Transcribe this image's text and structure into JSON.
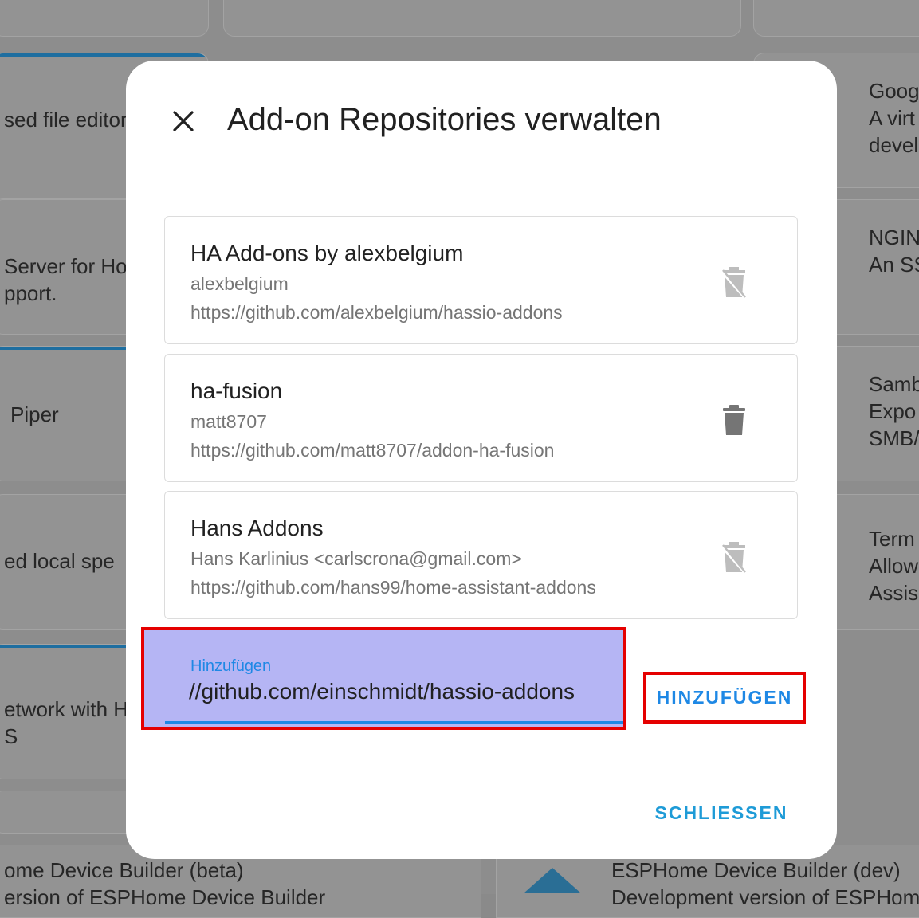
{
  "background": {
    "left_column": [
      {
        "text": "sed file editor"
      },
      {
        "text": "Server for Ho"
      },
      {
        "text": "pport."
      },
      {
        "text": "Piper"
      },
      {
        "text": "ed local spe"
      },
      {
        "text": "etwork with H"
      },
      {
        "text": "S"
      }
    ],
    "right_column": [
      {
        "title": "Goog",
        "line1": "A virt",
        "line2": "devel"
      },
      {
        "title": "NGIN",
        "line1": "An SS"
      },
      {
        "title": "Samb",
        "line1": "Expo",
        "line2": "SMB/"
      },
      {
        "title": "Term",
        "line1": "Allow",
        "line2": "Assis"
      }
    ],
    "bottom": {
      "left_title": "ome Device Builder (beta)",
      "left_desc": "ersion of ESPHome Device Builder",
      "right_title": "ESPHome Device Builder (dev)",
      "right_desc": "Development version of ESPHom"
    }
  },
  "dialog": {
    "title": "Add-on Repositories verwalten",
    "repositories": [
      {
        "name": "HA Add-ons by alexbelgium",
        "maintainer": "alexbelgium",
        "url": "https://github.com/alexbelgium/hassio-addons",
        "deletable": false
      },
      {
        "name": "ha-fusion",
        "maintainer": "matt8707",
        "url": "https://github.com/matt8707/addon-ha-fusion",
        "deletable": true
      },
      {
        "name": "Hans Addons",
        "maintainer": "Hans Karlinius <carlscrona@gmail.com>",
        "url": "https://github.com/hans99/home-assistant-addons",
        "deletable": false
      }
    ],
    "add_field": {
      "label": "Hinzufügen",
      "value": "//github.com/einschmidt/hassio-addons"
    },
    "add_button": "HINZUFÜGEN",
    "close_button": "SCHLIESSEN"
  },
  "colors": {
    "accent": "#1e88e5",
    "highlight": "#e50000",
    "trash_enabled": "#757575",
    "trash_disabled": "#bdbdbd"
  }
}
